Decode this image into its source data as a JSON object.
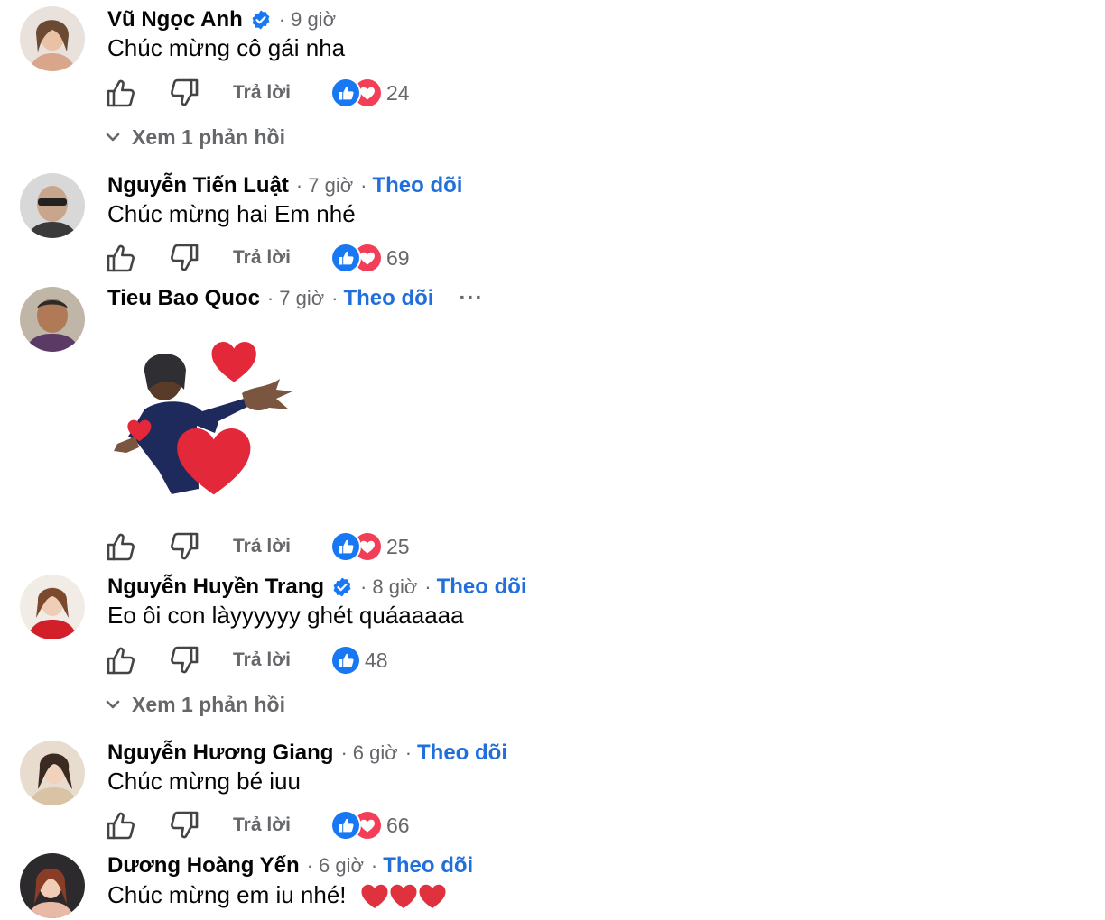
{
  "comments": [
    {
      "name": "Vũ Ngọc Anh",
      "verified": true,
      "time": "9 giờ",
      "follow": "",
      "text": "Chúc mừng cô gái nha",
      "reply_label": "Trả lời",
      "reactions": [
        "like",
        "love"
      ],
      "reaction_count": "24",
      "replies_label": "Xem 1 phản hồi"
    },
    {
      "name": "Nguyễn Tiến Luật",
      "verified": false,
      "time": "7 giờ",
      "follow": "Theo dõi",
      "text": "Chúc mừng hai Em nhé",
      "reply_label": "Trả lời",
      "reactions": [
        "like",
        "love"
      ],
      "reaction_count": "69"
    },
    {
      "name": "Tieu Bao Quoc",
      "verified": false,
      "time": "7 giờ",
      "follow": "Theo dõi",
      "more": "···",
      "attachment": "sticker-hug-hearts",
      "reply_label": "Trả lời",
      "reactions": [
        "like",
        "love"
      ],
      "reaction_count": "25"
    },
    {
      "name": "Nguyễn Huyền Trang",
      "verified": true,
      "time": "8 giờ",
      "follow": "Theo dõi",
      "text": "Eo ôi con làyyyyyy ghét quáaaaaa",
      "reply_label": "Trả lời",
      "reactions": [
        "like"
      ],
      "reaction_count": "48",
      "replies_label": "Xem 1 phản hồi"
    },
    {
      "name": "Nguyễn Hương Giang",
      "verified": false,
      "time": "6 giờ",
      "follow": "Theo dõi",
      "text": "Chúc mừng bé iuu",
      "reply_label": "Trả lời",
      "reactions": [
        "like",
        "love"
      ],
      "reaction_count": "66"
    },
    {
      "name": "Dương Hoàng Yến",
      "verified": false,
      "time": "6 giờ",
      "follow": "Theo dõi",
      "text": "Chúc mừng em iu nhé!",
      "emoji": "❤️❤️❤️"
    }
  ],
  "colors": {
    "link_blue": "#216fdb",
    "secondary_text": "#65676b",
    "like_blue": "#1877f2",
    "love_red": "#f33e58"
  },
  "icons": {
    "like": "thumbs-up-icon",
    "dislike": "thumbs-down-icon",
    "verified": "verified-badge-icon",
    "expand": "chevron-down-icon"
  }
}
